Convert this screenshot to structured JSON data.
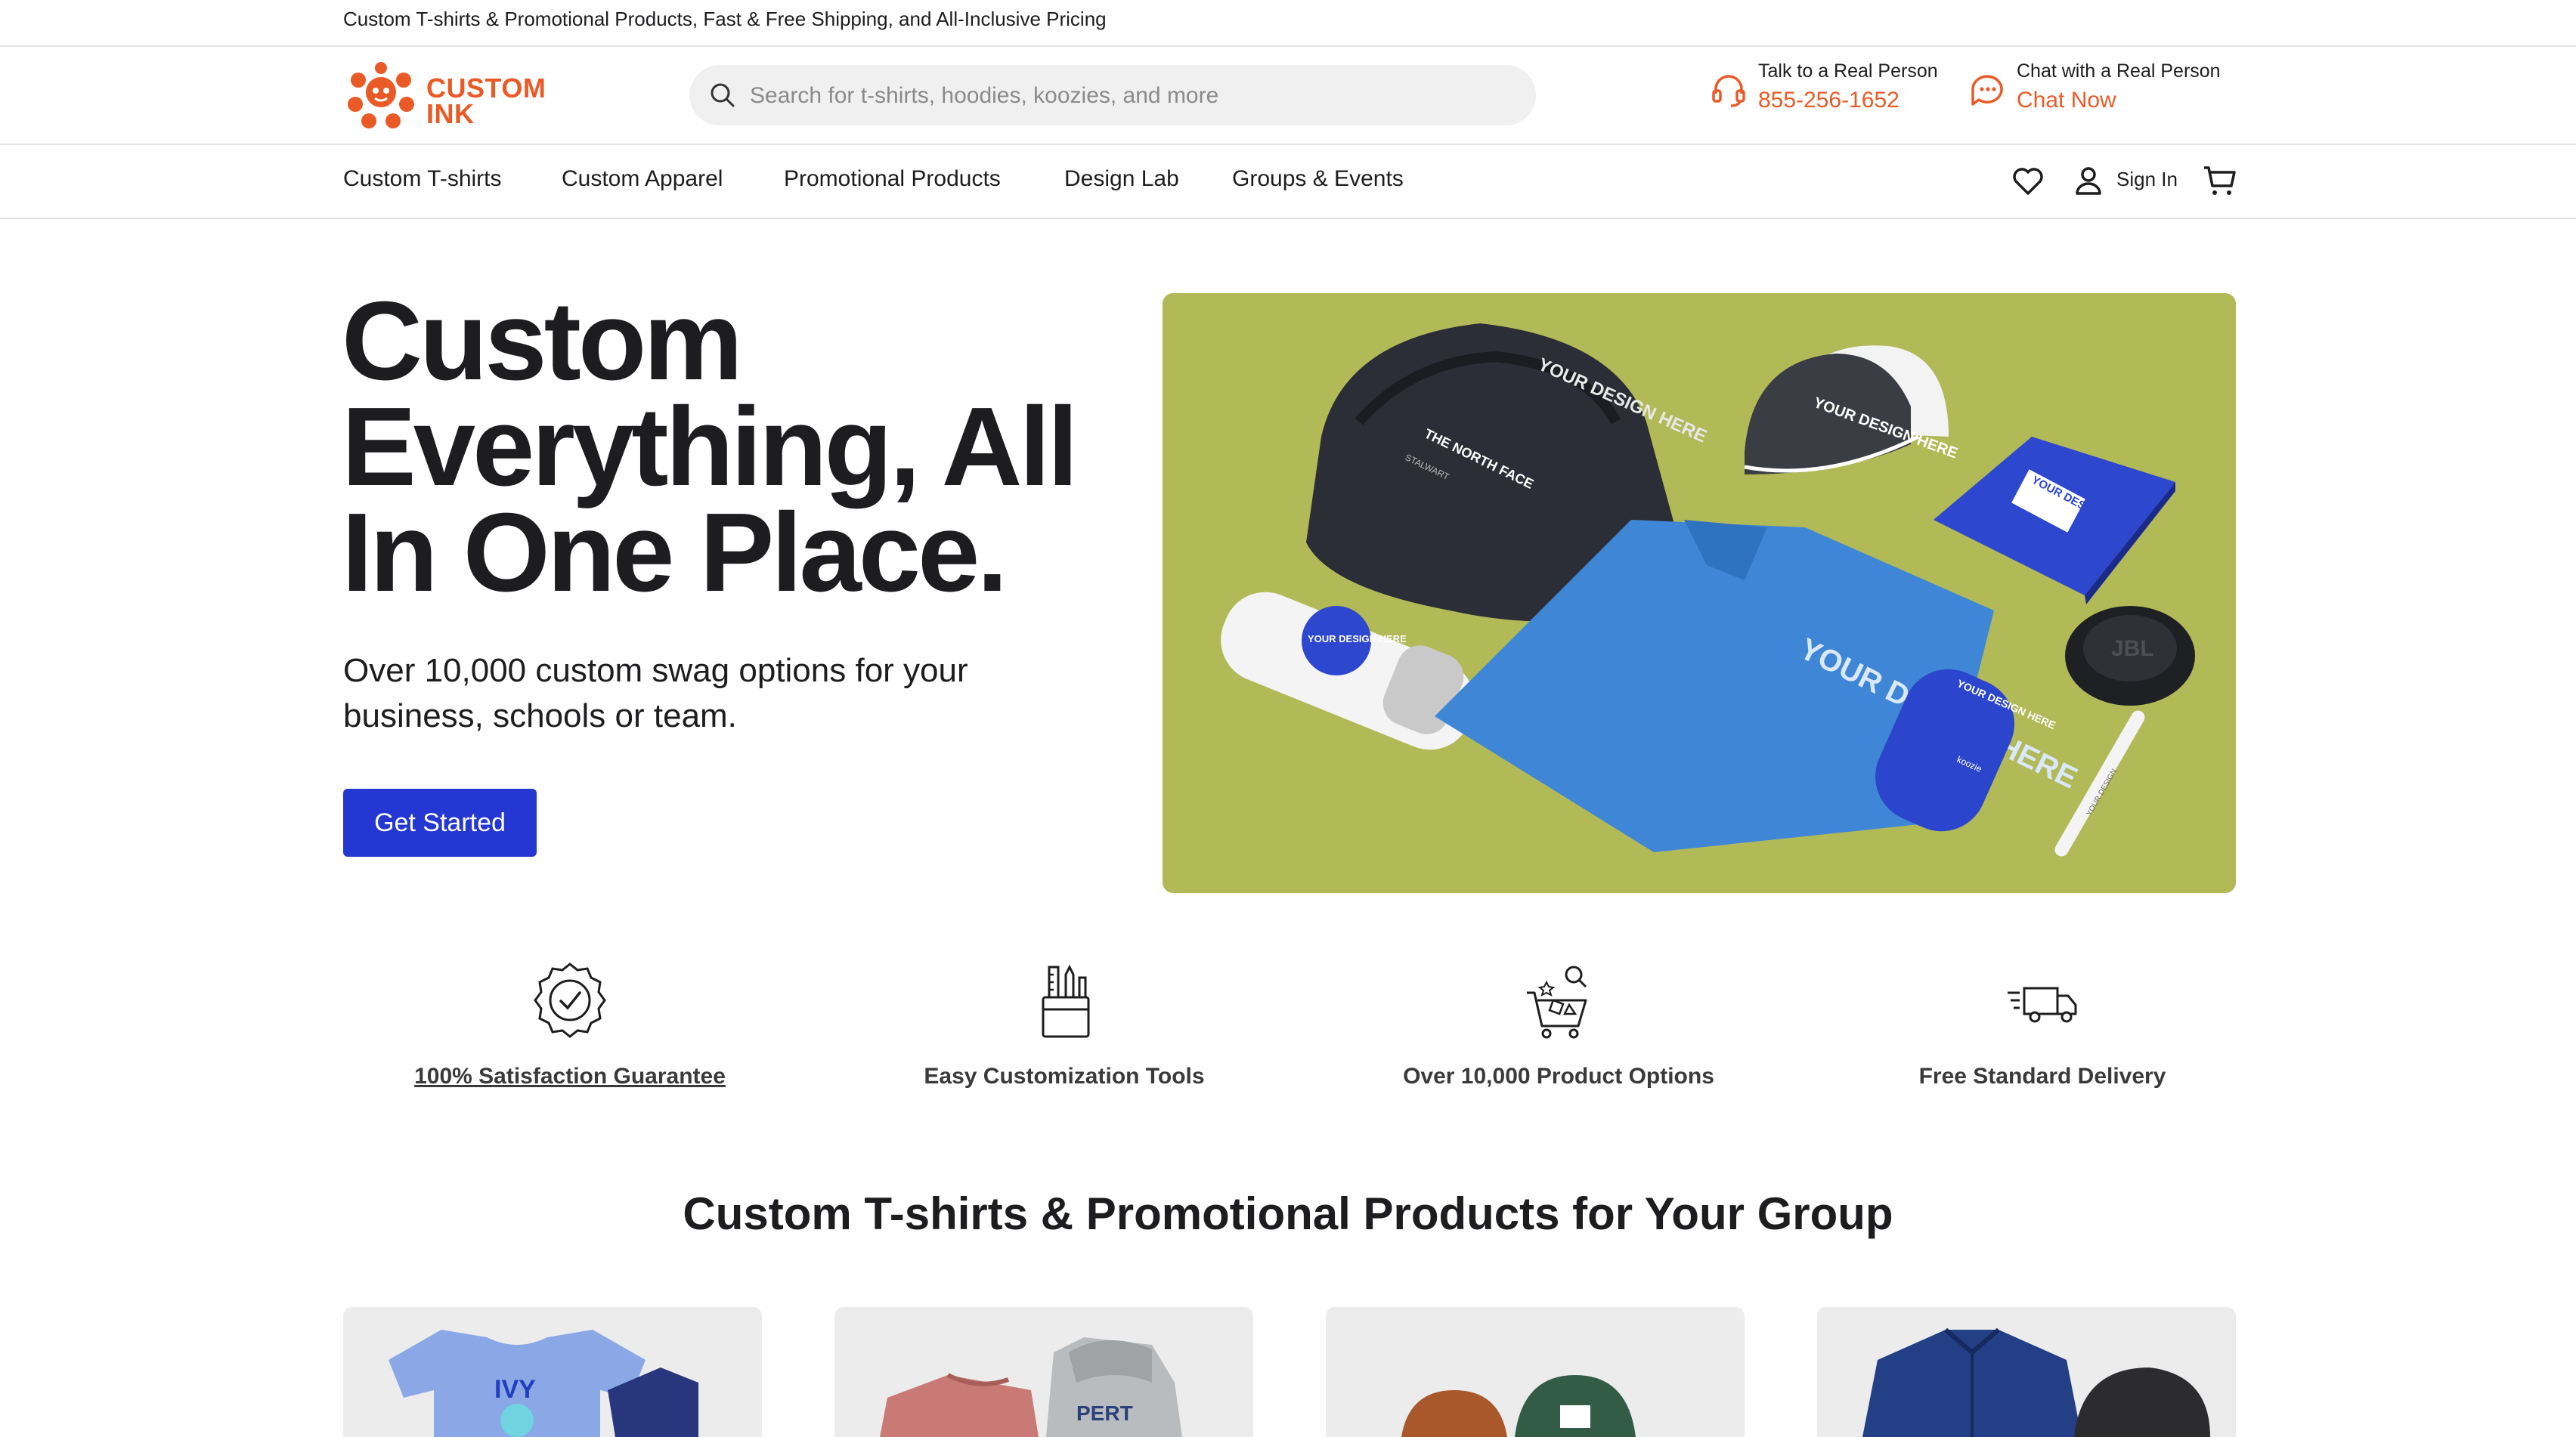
{
  "announcement": "Custom T-shirts & Promotional Products, Fast & Free Shipping, and All-Inclusive Pricing",
  "brand": {
    "line1": "CUSTOM",
    "line2": "INK",
    "color": "#ea5a27"
  },
  "search": {
    "placeholder": "Search for t-shirts, hoodies, koozies, and more",
    "icon": "search-icon"
  },
  "contact": {
    "phone": {
      "label": "Talk to a Real Person",
      "value": "855-256-1652",
      "icon": "headset-icon"
    },
    "chat": {
      "label": "Chat with a Real Person",
      "value": "Chat Now",
      "icon": "chat-icon"
    }
  },
  "nav": {
    "items": [
      "Custom T-shirts",
      "Custom Apparel",
      "Promotional Products",
      "Design Lab",
      "Groups & Events"
    ],
    "sign_in": "Sign In",
    "icons": [
      "heart-icon",
      "user-icon",
      "cart-icon"
    ]
  },
  "hero": {
    "title": "Custom Everything, All In One Place.",
    "subtitle": "Over 10,000 custom swag options for your business, schools or team.",
    "cta": "Get Started",
    "cta_color": "#2437d2",
    "image_bg": "#b2b957",
    "mockup_text": "YOUR DESIGN HERE",
    "backpack_brand": "THE NORTH FACE",
    "backpack_model": "STALWART",
    "speaker_brand": "JBL",
    "can_brand": "koozie",
    "pen_text": "YOUR DESIGN"
  },
  "features": [
    {
      "label": "100% Satisfaction Guarantee",
      "icon": "badge-check-icon"
    },
    {
      "label": "Easy Customization Tools",
      "icon": "tools-icon"
    },
    {
      "label": "Over 10,000 Product Options",
      "icon": "shopping-cart-icon"
    },
    {
      "label": "Free Standard Delivery",
      "icon": "delivery-truck-icon"
    }
  ],
  "section": {
    "title": "Custom T-shirts & Promotional Products for Your Group"
  },
  "cards": {
    "tee_text": "IVY",
    "hoodie_text": "PERT"
  }
}
